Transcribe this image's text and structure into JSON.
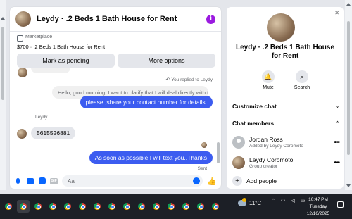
{
  "chat": {
    "title": "Leydy · .2 Beds 1 Bath House for Rent",
    "marketplace_label": "Marketplace",
    "marketplace_item": "$700 · .2 Beds 1 Bath House for Rent",
    "buttons": {
      "mark_pending": "Mark as pending",
      "more_options": "More options"
    },
    "replied_note": "You replied to Leydy",
    "quoted_message": "Hello, good morning, I want to clarify that I will deal directly with th...",
    "messages": [
      {
        "from": "me",
        "text": "please ,share your contact  number for details."
      },
      {
        "from": "Leydy",
        "text": "5615526881"
      },
      {
        "from": "me",
        "text": "As soon as possible I will text you..Thanks"
      }
    ],
    "sender_name": "Leydy",
    "sent_status": "Sent",
    "composer_placeholder": "Aa",
    "gif_label": "GIF"
  },
  "side": {
    "title": "Leydy · .2 Beds 1 Bath House for Rent",
    "actions": {
      "mute": "Mute",
      "search": "Search"
    },
    "customize_chat": "Customize chat",
    "chat_members": "Chat members",
    "members": [
      {
        "name": "Jordan Ross",
        "sub": "Added by Leydy Coromoto"
      },
      {
        "name": "Leydy Coromoto",
        "sub": "Group creator"
      }
    ],
    "add_people": "Add people"
  },
  "taskbar": {
    "temperature": "11°C",
    "time": "10:47 PM",
    "day": "Tuesday",
    "date": "12/16/2025"
  },
  "colors": {
    "accent": "#0866ff",
    "bubble_out": "#3c5cf0",
    "info_icon": "#9b1be0"
  }
}
